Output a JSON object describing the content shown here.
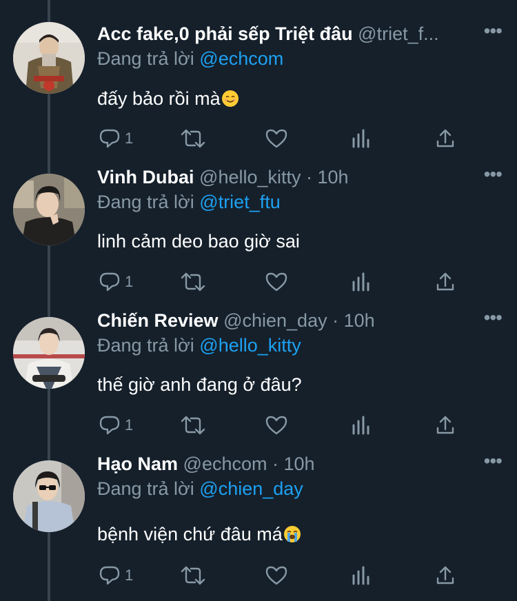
{
  "tweets": [
    {
      "name": "Acc fake,0 phải sếp Triệt đâu",
      "meta": "@triet_f...",
      "reply_prefix": "Đang trả lời",
      "reply_to": "@echcom",
      "text": "đấy bảo rồi mà",
      "emoji": "smiling-face",
      "reply_count": "1"
    },
    {
      "name": "Vinh Dubai",
      "meta": "@hello_kitty · 10h",
      "reply_prefix": "Đang trả lời",
      "reply_to": "@triet_ftu",
      "text": "linh cảm deo bao giờ sai",
      "emoji": "",
      "reply_count": "1"
    },
    {
      "name": "Chiến Review",
      "meta": "@chien_day · 10h",
      "reply_prefix": "Đang trả lời",
      "reply_to": "@hello_kitty",
      "text": "thế giờ anh đang ở đâu?",
      "emoji": "",
      "reply_count": "1"
    },
    {
      "name": "Hạo Nam",
      "meta": "@echcom · 10h",
      "reply_prefix": "Đang trả lời",
      "reply_to": "@chien_day",
      "text": "bệnh viện chứ đâu má",
      "emoji": "loudly-crying-face",
      "reply_count": "1"
    }
  ],
  "icons": {
    "reply": "reply-icon",
    "retweet": "retweet-icon",
    "like": "heart-icon",
    "analytics": "analytics-icon",
    "share": "share-icon",
    "more": "more-icon"
  },
  "colors": {
    "background": "#15202b",
    "primary_text": "#ffffff",
    "secondary_text": "#8899a6",
    "link": "#1da1f2",
    "thread_line": "#38444d"
  }
}
